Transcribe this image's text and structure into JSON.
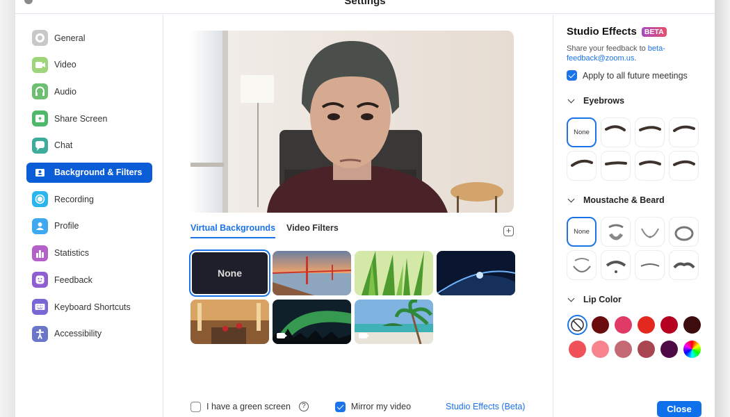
{
  "window": {
    "title": "Settings"
  },
  "sidebar": {
    "items": [
      {
        "label": "General",
        "icon": "gear-icon",
        "color": "#c8c8c8"
      },
      {
        "label": "Video",
        "icon": "video-camera-icon",
        "color": "#9fd57a"
      },
      {
        "label": "Audio",
        "icon": "headphones-icon",
        "color": "#6cbf6e"
      },
      {
        "label": "Share Screen",
        "icon": "share-screen-icon",
        "color": "#4fb86a"
      },
      {
        "label": "Chat",
        "icon": "chat-bubble-icon",
        "color": "#3eac9a"
      },
      {
        "label": "Background & Filters",
        "icon": "person-card-icon",
        "color": "#0b5cd7",
        "active": true
      },
      {
        "label": "Recording",
        "icon": "record-icon",
        "color": "#2bb5ee"
      },
      {
        "label": "Profile",
        "icon": "profile-icon",
        "color": "#3ea8f0"
      },
      {
        "label": "Statistics",
        "icon": "bar-chart-icon",
        "color": "#b460c9"
      },
      {
        "label": "Feedback",
        "icon": "smiley-icon",
        "color": "#8f5ed0"
      },
      {
        "label": "Keyboard Shortcuts",
        "icon": "keyboard-icon",
        "color": "#7a66d4"
      },
      {
        "label": "Accessibility",
        "icon": "accessibility-icon",
        "color": "#6a76c8"
      }
    ]
  },
  "main": {
    "tabs": [
      {
        "label": "Virtual Backgrounds",
        "active": true
      },
      {
        "label": "Video Filters",
        "active": false
      }
    ],
    "add_button_label": "+",
    "backgrounds": [
      {
        "label": "None",
        "kind": "none",
        "selected": true
      },
      {
        "label": "Golden Gate Bridge",
        "kind": "image",
        "video": false
      },
      {
        "label": "Grass",
        "kind": "image",
        "video": false
      },
      {
        "label": "Earth from space",
        "kind": "image",
        "video": false
      },
      {
        "label": "Hotel lobby",
        "kind": "image",
        "video": false
      },
      {
        "label": "Aurora",
        "kind": "image",
        "video": true
      },
      {
        "label": "Beach",
        "kind": "image",
        "video": true
      }
    ],
    "green_screen": {
      "label": "I have a green screen",
      "checked": false,
      "help": "?"
    },
    "mirror": {
      "label": "Mirror my video",
      "checked": true
    },
    "studio_link": "Studio Effects (Beta)"
  },
  "studio": {
    "title": "Studio Effects",
    "badge": "BETA",
    "feedback_prefix": "Share your feedback to ",
    "feedback_email": "beta-feedback@zoom.us",
    "feedback_suffix": ".",
    "apply_all": {
      "label": "Apply to all future meetings",
      "checked": true
    },
    "sections": {
      "eyebrows": {
        "title": "Eyebrows",
        "none_label": "None",
        "count": 8
      },
      "beard": {
        "title": "Moustache & Beard",
        "none_label": "None",
        "count": 8
      },
      "lip": {
        "title": "Lip Color"
      }
    },
    "lip_colors": [
      "none",
      "#6a0b0e",
      "#e03a66",
      "#e3291f",
      "#b5001f",
      "#3d0d0d",
      "#f0525a",
      "#f8848e",
      "#c56a75",
      "#a84550",
      "#4d0a45",
      "rainbow"
    ],
    "close_label": "Close"
  }
}
